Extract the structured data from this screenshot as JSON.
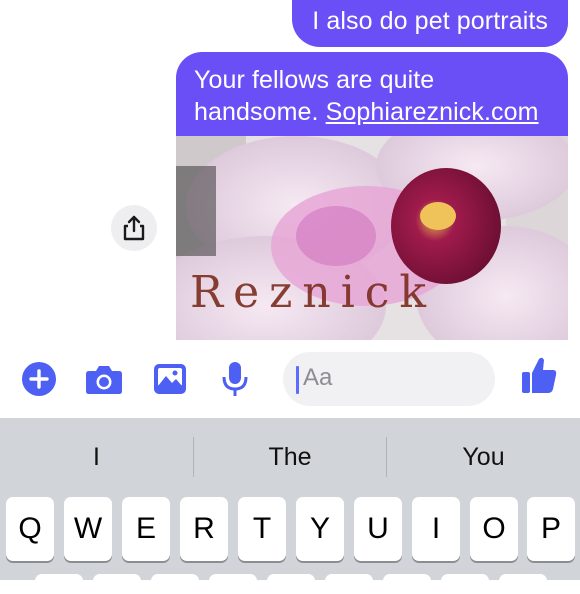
{
  "thread": {
    "sent_message": "I also do pet portraits",
    "reply_line1": "Your fellows are quite",
    "reply_line2_prefix": "handsome. ",
    "reply_link": "Sophiareznick.com",
    "photo_caption": "Reznick"
  },
  "composer": {
    "placeholder": "Aa",
    "icons": [
      "plus-icon",
      "camera-icon",
      "image-icon",
      "microphone-icon",
      "emoji-icon",
      "thumbs-up-icon"
    ]
  },
  "keyboard": {
    "suggestions": [
      "I",
      "The",
      "You"
    ],
    "row1": [
      "Q",
      "W",
      "E",
      "R",
      "T",
      "Y",
      "U",
      "I",
      "O",
      "P"
    ]
  },
  "colors": {
    "accent": "#6b4ff6",
    "icon": "#4e5ff4",
    "keyboard_bg": "#d1d4d9"
  }
}
